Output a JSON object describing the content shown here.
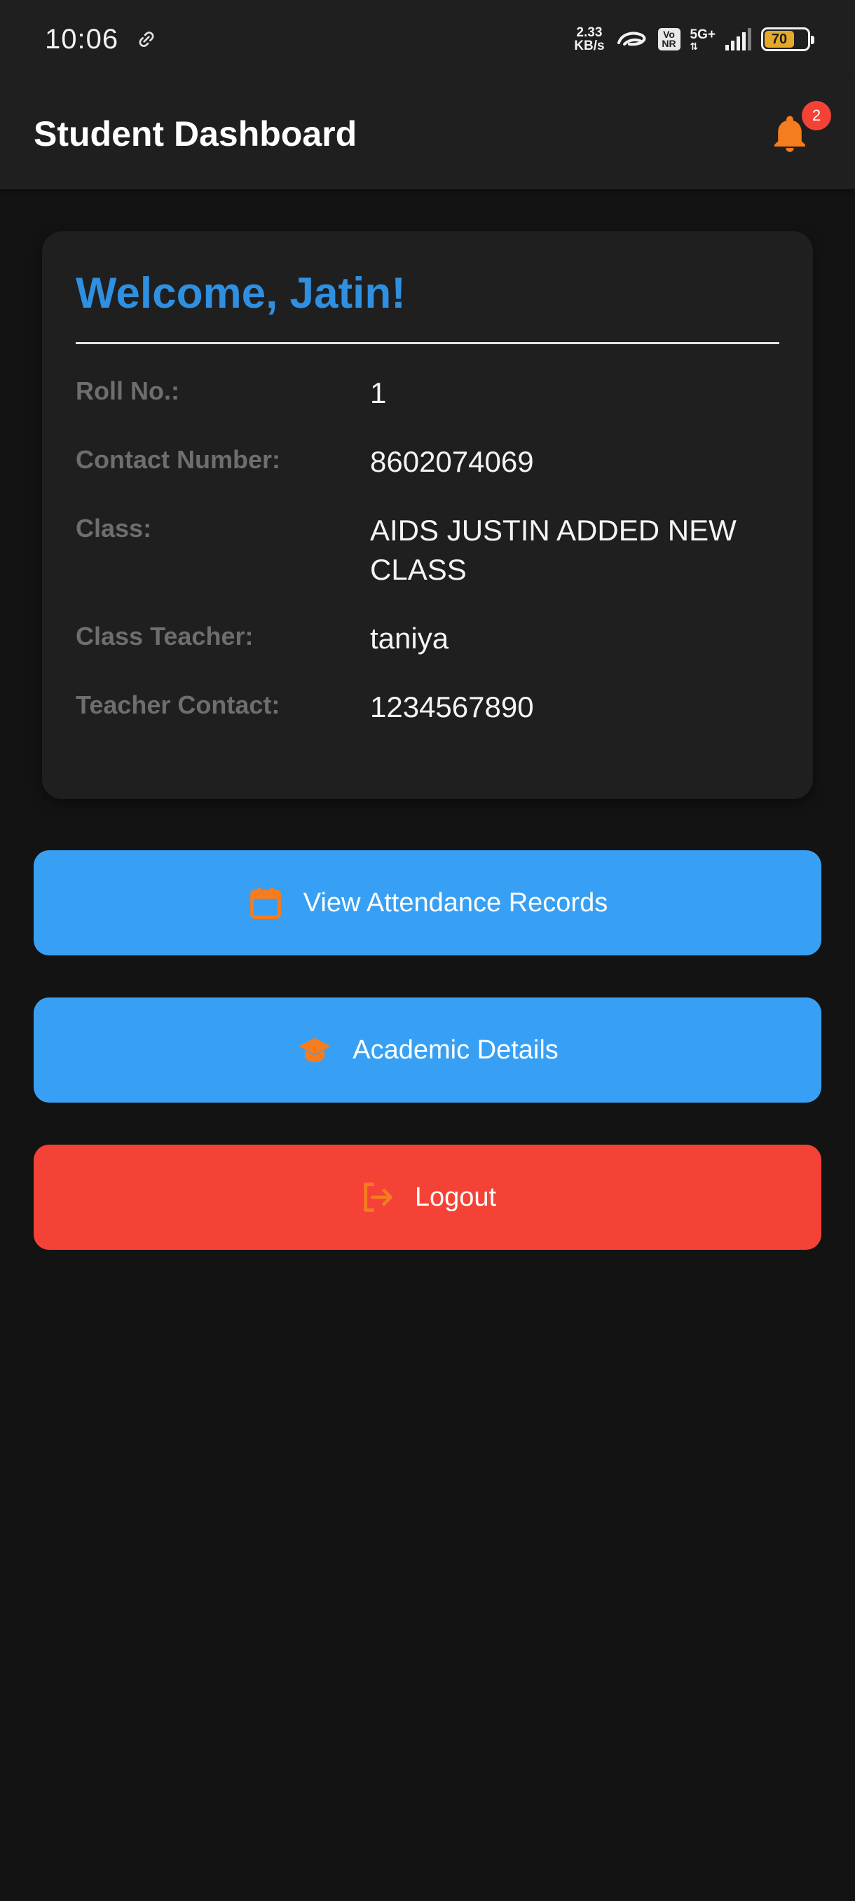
{
  "status_bar": {
    "time": "10:06",
    "net_speed_value": "2.33",
    "net_speed_unit": "KB/s",
    "volte_top": "Vo",
    "volte_bottom": "NR",
    "network_type": "5G+",
    "battery_level": "70",
    "colors": {
      "battery_fill": "#e5a92a"
    }
  },
  "app_bar": {
    "title": "Student Dashboard",
    "notification_count": "2",
    "icon": "bell-icon"
  },
  "profile_card": {
    "welcome": "Welcome, Jatin!",
    "rows": [
      {
        "label": "Roll No.:",
        "value": "1"
      },
      {
        "label": "Contact Number:",
        "value": "8602074069"
      },
      {
        "label": "Class:",
        "value": "AIDS JUSTIN ADDED NEW CLASS"
      },
      {
        "label": "Class Teacher:",
        "value": "taniya"
      },
      {
        "label": "Teacher Contact:",
        "value": "1234567890"
      }
    ]
  },
  "actions": {
    "attendance": {
      "label": "View Attendance Records",
      "icon": "calendar-icon"
    },
    "academic": {
      "label": "Academic Details",
      "icon": "graduation-cap-icon"
    },
    "logout": {
      "label": "Logout",
      "icon": "logout-icon"
    }
  },
  "colors": {
    "background": "#131313",
    "surface": "#1f1f1f",
    "accent_blue": "#37a0f4",
    "welcome_blue": "#2f8fe0",
    "danger_red": "#f44336",
    "icon_orange": "#f57c1f"
  }
}
